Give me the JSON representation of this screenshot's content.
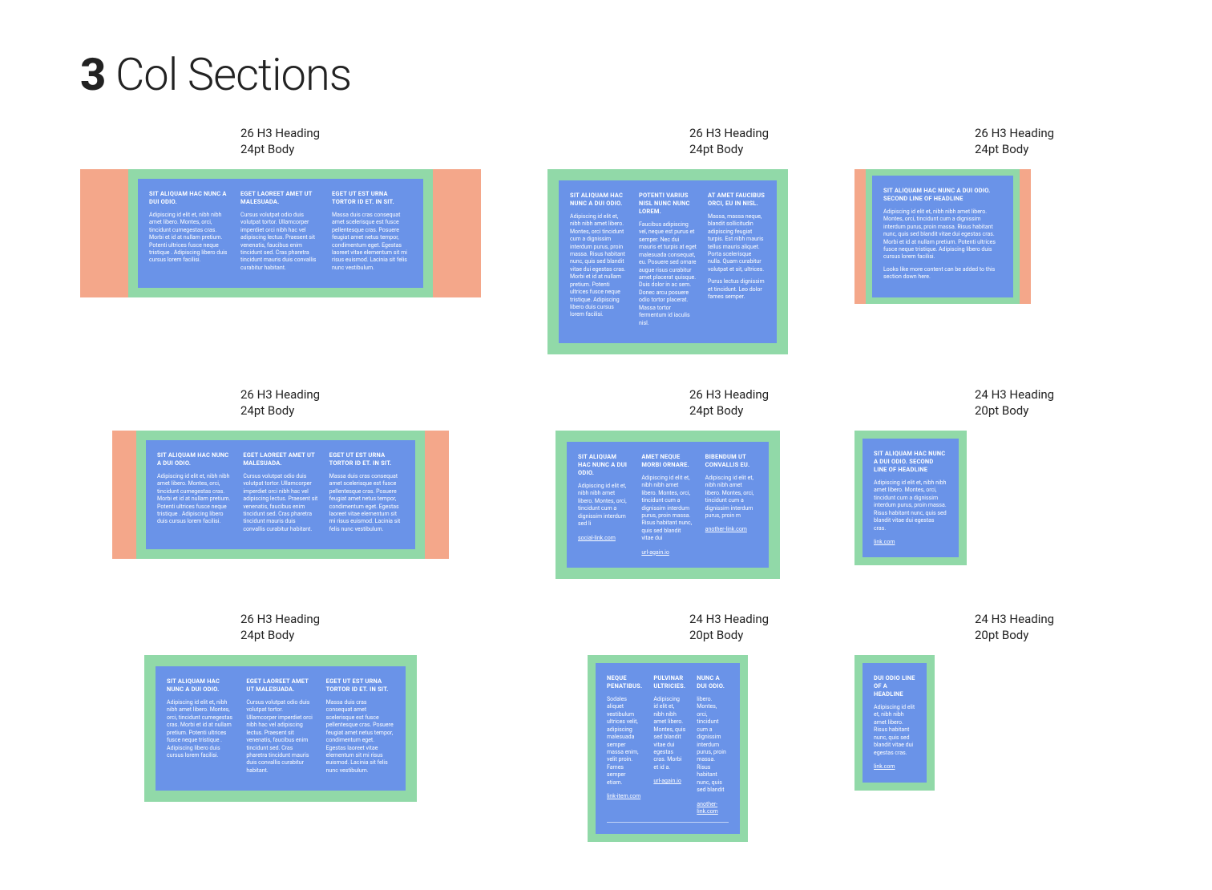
{
  "title": {
    "bold": "3",
    "rest": " Col Sections"
  },
  "labels": {
    "h26b24": {
      "line1": "26 H3 Heading",
      "line2": "24pt Body"
    },
    "h24b20": {
      "line1": "24 H3 Heading",
      "line2": "20pt Body"
    }
  },
  "copy": {
    "colA": {
      "h": "SIT ALIQUAM HAC NUNC A DUI ODIO.",
      "p": "Adipiscing id elit et, nibh nibh amet libero. Montes, orci, tincidunt cumegestas cras. Morbi et id at nullam pretium. Potenti ultrices fusce neque tristique . Adipiscing libero duis cursus lorem facilisi."
    },
    "colB": {
      "h": "EGET LAOREET AMET UT MALESUADA.",
      "p": "Cursus volutpat odio duis volutpat tortor. Ullamcorper imperdiet orci nibh hac vel adipiscing lectus. Praesent sit venenatis, faucibus enim tincidunt sed. Cras pharetra tincidunt mauris duis convallis curabitur habitant."
    },
    "colC": {
      "h": "EGET UT EST URNA TORTOR ID ET. IN SIT.",
      "p": "Massa duis cras consequat amet scelerisque est fusce pellentesque cras. Posuere feugiat amet netus tempor, condimentum eget. Egestas laoreet vitae elementum sit mi risus euismod. Lacinia sit felis nunc vestibulum."
    },
    "var2": {
      "a": {
        "h": "SIT ALIQUAM HAC NUNC A DUI ODIO.",
        "p": "Adipiscing id elit et, nibh nibh amet libero. Montes, orci tincidunt cum a dignissim interdum purus, proin massa. Risus habitant nunc, quis sed blandit vitae dui egestas cras. Morbi et id at nullam pretium. Potenti ultrices fusce neque tristique. Adipiscing libero duis cursus lorem facilisi."
      },
      "b": {
        "h": "POTENTI VARIUS NISL NUNC NUNC LOREM.",
        "p": "Faucibus adipiscing vel, neque est purus et semper. Nec dui mauris et turpis at eget malesuada consequat, eu. Posuere sed ornare augue risus curabitur amet placerat quisque. Duis dolor in ac sem. Donec arcu posuere odio tortor placerat. Massa tortor fermentum id iaculis nisl."
      },
      "c": {
        "h": "AT AMET FAUCIBUS ORCI, EU IN NISL.",
        "p": "Massa, massa neque, blandit sollicitudin adipiscing feugiat turpis. Est nibh mauris tellus mauris aliquet. Porta scelerisque nulla. Quam curabitur volutpat et sit, ultrices.",
        "p2": "Purus lectus dignissim et tincidunt. Leo dolor fames semper."
      }
    },
    "single": {
      "h": "SIT ALIQUAM HAC NUNC A DUI ODIO. SECOND LINE OF HEADLINE",
      "p": "Adipiscing id elit et, nibh nibh amet libero. Montes, orci, tincidunt cum a dignissim interdum purus, proin massa. Risus habitant nunc, quis sed blandit vitae dui egestas cras. Morbi et id at nullam pretium. Potenti ultrices fusce neque tristique. Adipiscing libero duis cursus lorem facilisi.",
      "p2": "Looks like more content can be added to this section down here."
    },
    "linksRow": {
      "a": {
        "h": "SIT ALIQUAM HAC NUNC A DUI ODIO.",
        "p": "Adipiscing id elit et, nibh nibh amet libero. Montes, orci, tincidunt cum a dignissim interdum sed li",
        "link": "social-link.com"
      },
      "b": {
        "h": "AMET NEQUE MORBI ORNARE.",
        "p": "Adipiscing id elit et, nibh nibh amet libero. Montes, orci, tincidunt cum a dignissim interdum purus, proin massa. Risus habitant nunc, quis sed blandit vitae dui",
        "link": "url-again.io"
      },
      "c": {
        "h": "BIBENDUM UT CONVALLIS EU.",
        "p": "Adipiscing id elit et, nibh nibh amet libero. Montes, orci, tincidunt cum a dignissim interdum purus, proin m",
        "link": "another-link.com"
      }
    },
    "small3": {
      "h": "SIT ALIQUAM HAC NUNC A DUI ODIO. SECOND LINE OF HEADLINE",
      "p": "Adipiscing id elit et, nibh nibh amet libero. Montes, orci, tincidunt cum a dignissim interdum purus, proin massa. Risus habitant nunc, quis sed blandit vitae dui egestas cras.",
      "link": "link.com"
    },
    "tinyRow": {
      "a": {
        "h": "NEQUE PENATIBUS.",
        "p": "Sodales aliquet vestibulum ultrices velit, adipiscing malesuada semper massa enim, velit proin. Fames semper etiam.",
        "link": "link-item.com"
      },
      "b": {
        "h": "PULVINAR ULTRICIES.",
        "p": "Adipiscing id elit et, nibh nibh amet libero. Montes, quis sed blandit vitae dui egestas cras. Morbi et id a.",
        "link": "url-again.io"
      },
      "c": {
        "h": "NUNC A DUI ODIO.",
        "p": "libero. Montes, orci, tincidunt cum a dignissim interdum purus, proin massa. Risus habitant nunc, quis sed blandit",
        "link": "another-link.com"
      }
    },
    "tinySingle": {
      "h": "DUI ODIO LINE OF A HEADLINE",
      "p": "Adipiscing id elit et, nibh nibh amet libero. Risus habitant nunc, quis sed blandit vitae dui egestas cras.",
      "link": "link.com"
    }
  }
}
